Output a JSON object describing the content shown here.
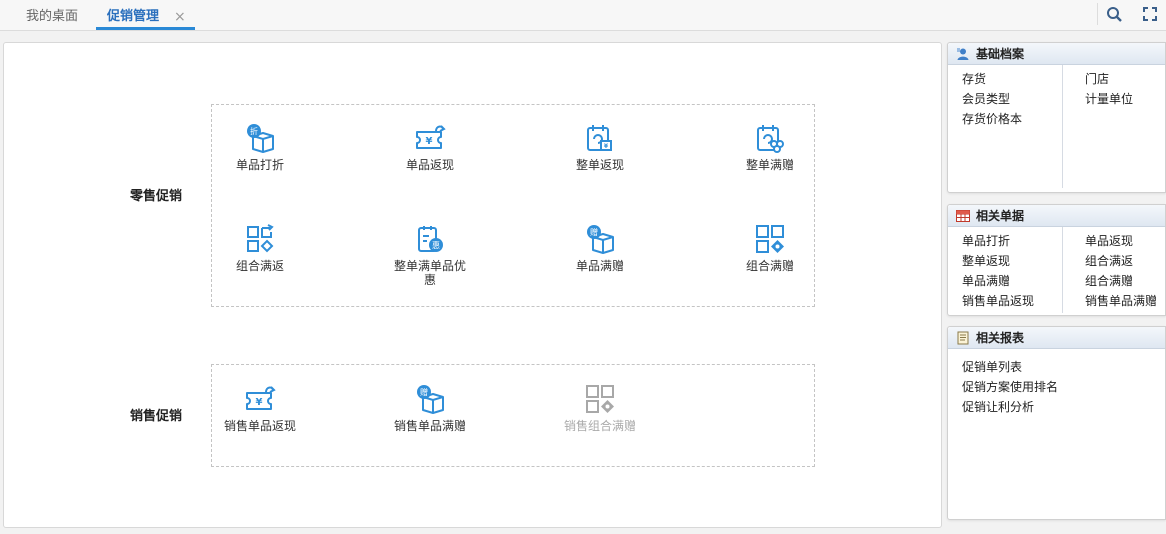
{
  "tabs": {
    "home": "我的桌面",
    "active": "促销管理",
    "close": "×"
  },
  "toolbar": {
    "search_icon": "search-icon",
    "fullscreen_icon": "fullscreen-icon"
  },
  "colors": {
    "accent": "#2a89d6",
    "icon_blue": "#2f8ed8",
    "disabled": "#a8a8a8"
  },
  "retail": {
    "label": "零售促销",
    "items": [
      {
        "label": "单品打折",
        "icon": "discount-box-icon",
        "badge": "折"
      },
      {
        "label": "单品返现",
        "icon": "cashback-ticket-icon"
      },
      {
        "label": "整单返现",
        "icon": "order-cashback-icon"
      },
      {
        "label": "整单满赠",
        "icon": "order-gift-icon"
      },
      {
        "label": "组合满返",
        "icon": "combo-return-icon"
      },
      {
        "label": "整单满单品优惠",
        "icon": "order-item-discount-icon",
        "badge": "惠"
      },
      {
        "label": "单品满赠",
        "icon": "item-gift-box-icon",
        "badge": "赠"
      },
      {
        "label": "组合满赠",
        "icon": "combo-gift-icon"
      }
    ]
  },
  "sales": {
    "label": "销售促销",
    "items": [
      {
        "label": "销售单品返现",
        "icon": "cashback-ticket-icon",
        "disabled": false
      },
      {
        "label": "销售单品满赠",
        "icon": "item-gift-box-icon",
        "badge": "赠",
        "disabled": false
      },
      {
        "label": "销售组合满赠",
        "icon": "combo-gift-icon",
        "disabled": true
      }
    ]
  },
  "panels": {
    "basic": {
      "title": "基础档案",
      "icon": "user-icon",
      "left": [
        "存货",
        "会员类型",
        "存货价格本"
      ],
      "right": [
        "门店",
        "计量单位"
      ]
    },
    "docs": {
      "title": "相关单据",
      "icon": "table-icon",
      "left": [
        "单品打折",
        "整单返现",
        "单品满赠",
        "销售单品返现"
      ],
      "right": [
        "单品返现",
        "组合满返",
        "组合满赠",
        "销售单品满赠"
      ]
    },
    "reports": {
      "title": "相关报表",
      "icon": "report-icon",
      "items": [
        "促销单列表",
        "促销方案使用排名",
        "促销让利分析"
      ]
    }
  }
}
